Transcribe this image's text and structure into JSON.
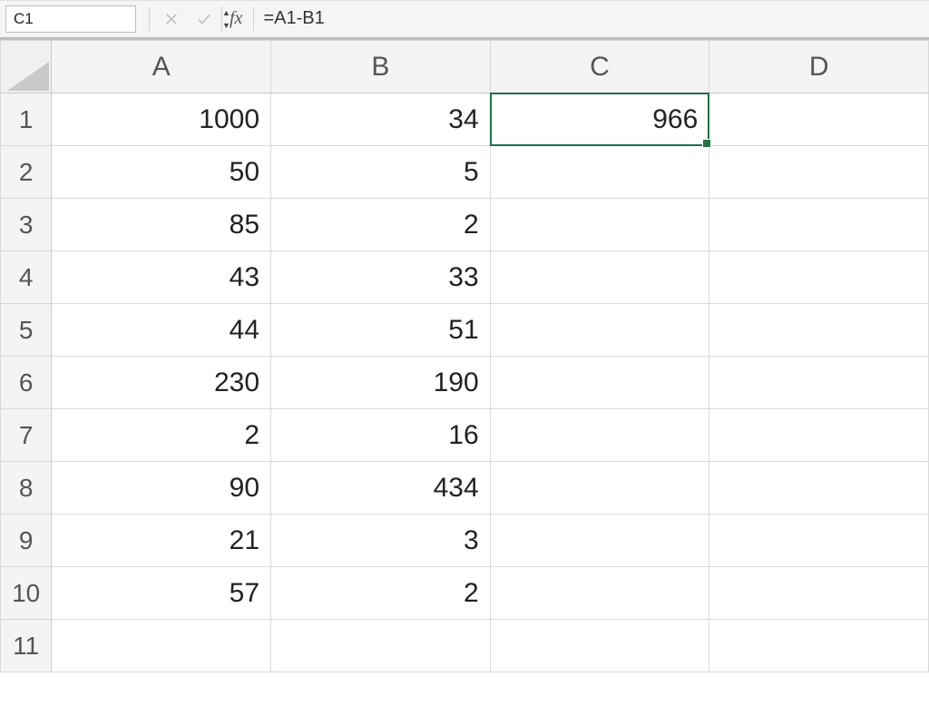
{
  "formula_bar": {
    "name_box_value": "C1",
    "fx_label": "fx",
    "formula_value": "=A1-B1"
  },
  "columns": [
    "A",
    "B",
    "C",
    "D"
  ],
  "rows": [
    "1",
    "2",
    "3",
    "4",
    "5",
    "6",
    "7",
    "8",
    "9",
    "10",
    "11"
  ],
  "selected_cell": "C1",
  "cells": {
    "A1": "1000",
    "B1": "34",
    "C1": "966",
    "A2": "50",
    "B2": "5",
    "A3": "85",
    "B3": "2",
    "A4": "43",
    "B4": "33",
    "A5": "44",
    "B5": "51",
    "A6": "230",
    "B6": "190",
    "A7": "2",
    "B7": "16",
    "A8": "90",
    "B8": "434",
    "A9": "21",
    "B9": "3",
    "A10": "57",
    "B10": "2"
  },
  "chart_data": {
    "type": "table",
    "columns": [
      "A",
      "B",
      "C"
    ],
    "rows": [
      {
        "A": 1000,
        "B": 34,
        "C": 966
      },
      {
        "A": 50,
        "B": 5
      },
      {
        "A": 85,
        "B": 2
      },
      {
        "A": 43,
        "B": 33
      },
      {
        "A": 44,
        "B": 51
      },
      {
        "A": 230,
        "B": 190
      },
      {
        "A": 2,
        "B": 16
      },
      {
        "A": 90,
        "B": 434
      },
      {
        "A": 21,
        "B": 3
      },
      {
        "A": 57,
        "B": 2
      }
    ],
    "note": "C1 = A1 - B1"
  }
}
